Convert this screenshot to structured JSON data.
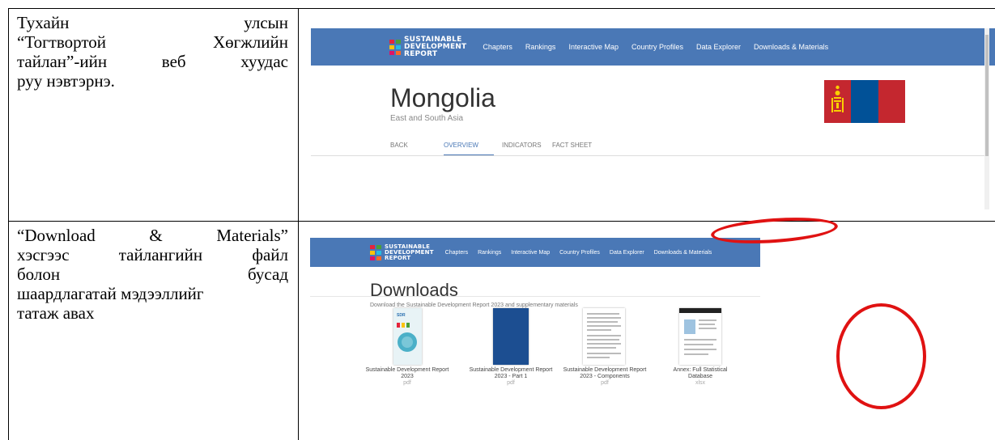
{
  "rows": [
    {
      "text_lines": [
        "Тухайн улсын",
        "“Тогтвортой Хөгжлийн",
        "тайлан”-ийн веб хуудас",
        "руу нэвтэрнэ."
      ]
    },
    {
      "text_lines": [
        "“Download & Materials”",
        "хэсгээс тайлангийн файл",
        "болон бусад",
        "шаардлагатай мэдээллийг",
        "татаж авах"
      ]
    }
  ],
  "site": {
    "logo": [
      "SUSTAINABLE",
      "DEVELOPMENT",
      "REPORT"
    ],
    "nav": [
      "Chapters",
      "Rankings",
      "Interactive Map",
      "Country Profiles",
      "Data Explorer",
      "Downloads & Materials"
    ]
  },
  "profile": {
    "country": "Mongolia",
    "region": "East and South Asia",
    "tabs": [
      "BACK",
      "OVERVIEW",
      "INDICATORS",
      "FACT SHEET"
    ],
    "active_tab": "OVERVIEW",
    "flag_colors": [
      "#c4272f",
      "#015197",
      "#c4272f"
    ]
  },
  "downloads": {
    "title": "Downloads",
    "subtitle": "Download the Sustainable Development Report 2023 and supplementary materials",
    "items": [
      {
        "caption": "Sustainable Development Report 2023",
        "sub": "pdf"
      },
      {
        "caption": "Sustainable Development Report 2023 - Part 1",
        "sub": "pdf"
      },
      {
        "caption": "Sustainable Development Report 2023 - Components",
        "sub": "pdf"
      },
      {
        "caption": "Annex: Full Statistical Database",
        "sub": "xlsx"
      }
    ]
  },
  "colors": {
    "navbar": "#4a78b6",
    "highlight": "#e01212"
  }
}
